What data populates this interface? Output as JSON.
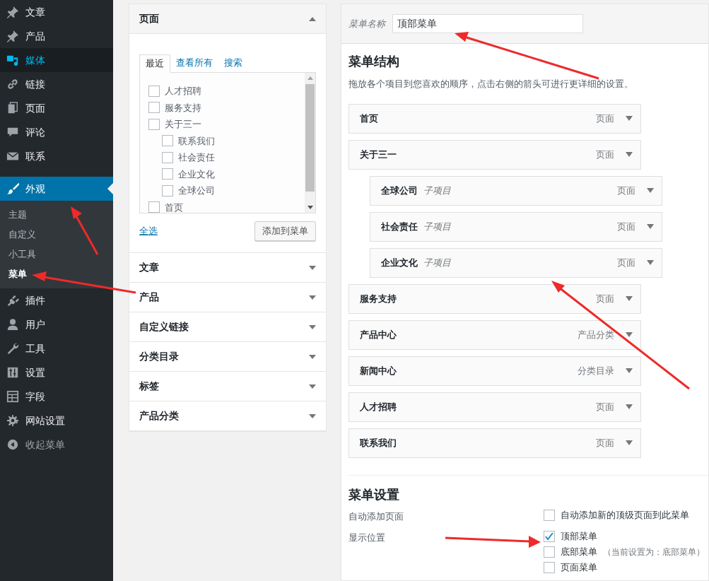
{
  "sidebar": {
    "items": [
      {
        "label": "文章",
        "selected": false,
        "highlighted": false
      },
      {
        "label": "产品",
        "selected": false,
        "highlighted": false
      },
      {
        "label": "媒体",
        "selected": false,
        "highlighted": true
      },
      {
        "label": "链接",
        "selected": false,
        "highlighted": false
      },
      {
        "label": "页面",
        "selected": false,
        "highlighted": false
      },
      {
        "label": "评论",
        "selected": false,
        "highlighted": false
      },
      {
        "label": "联系",
        "selected": false,
        "highlighted": false
      },
      {
        "label": "外观",
        "selected": true,
        "highlighted": false,
        "children": [
          {
            "label": "主题",
            "selected": false
          },
          {
            "label": "自定义",
            "selected": false
          },
          {
            "label": "小工具",
            "selected": false
          },
          {
            "label": "菜单",
            "selected": true
          }
        ]
      },
      {
        "label": "插件",
        "selected": false,
        "highlighted": false
      },
      {
        "label": "用户",
        "selected": false,
        "highlighted": false
      },
      {
        "label": "工具",
        "selected": false,
        "highlighted": false
      },
      {
        "label": "设置",
        "selected": false,
        "highlighted": false
      },
      {
        "label": "字段",
        "selected": false,
        "highlighted": false
      },
      {
        "label": "网站设置",
        "selected": false,
        "highlighted": false
      },
      {
        "label": "收起菜单",
        "selected": false,
        "highlighted": false
      }
    ]
  },
  "add_items": {
    "sections": [
      {
        "title": "页面",
        "expanded": true,
        "tabs": [
          {
            "label": "最近",
            "selected": true
          },
          {
            "label": "查看所有",
            "selected": false
          },
          {
            "label": "搜索",
            "selected": false
          }
        ],
        "pages": [
          {
            "label": "人才招聘",
            "checked": false
          },
          {
            "label": "服务支持",
            "checked": false
          },
          {
            "label": "关于三一",
            "checked": false,
            "children": [
              {
                "label": "联系我们",
                "checked": false
              },
              {
                "label": "社会责任",
                "checked": false
              },
              {
                "label": "企业文化",
                "checked": false
              },
              {
                "label": "全球公司",
                "checked": false
              }
            ]
          },
          {
            "label": "首页",
            "checked": false
          }
        ],
        "select_all": "全选",
        "add_button": "添加到菜单"
      },
      {
        "title": "文章",
        "expanded": false
      },
      {
        "title": "产品",
        "expanded": false
      },
      {
        "title": "自定义链接",
        "expanded": false
      },
      {
        "title": "分类目录",
        "expanded": false
      },
      {
        "title": "标签",
        "expanded": false
      },
      {
        "title": "产品分类",
        "expanded": false
      }
    ]
  },
  "menu_editor": {
    "name_label": "菜单名称",
    "name_value": "顶部菜单",
    "structure_title": "菜单结构",
    "structure_hint": "拖放各个项目到您喜欢的顺序，点击右侧的箭头可进行更详细的设置。",
    "items": [
      {
        "label": "首页",
        "type": "页面"
      },
      {
        "label": "关于三一",
        "type": "页面",
        "children": [
          {
            "label": "全球公司",
            "sub_label": "子项目",
            "type": "页面"
          },
          {
            "label": "社会责任",
            "sub_label": "子项目",
            "type": "页面"
          },
          {
            "label": "企业文化",
            "sub_label": "子项目",
            "type": "页面"
          }
        ]
      },
      {
        "label": "服务支持",
        "type": "页面"
      },
      {
        "label": "产品中心",
        "type": "产品分类"
      },
      {
        "label": "新闻中心",
        "type": "分类目录"
      },
      {
        "label": "人才招聘",
        "type": "页面"
      },
      {
        "label": "联系我们",
        "type": "页面"
      }
    ],
    "settings_title": "菜单设置",
    "settings": [
      {
        "label": "自动添加页面",
        "options": [
          {
            "label": "自动添加新的顶级页面到此菜单",
            "checked": false
          }
        ]
      },
      {
        "label": "显示位置",
        "options": [
          {
            "label": "顶部菜单",
            "checked": true
          },
          {
            "label": "底部菜单",
            "checked": false,
            "note": "（当前设置为：底部菜单）"
          },
          {
            "label": "页面菜单",
            "checked": false
          }
        ]
      }
    ]
  }
}
